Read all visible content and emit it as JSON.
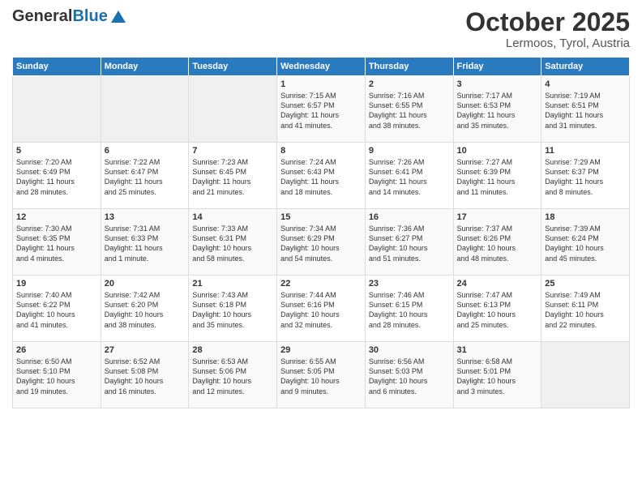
{
  "header": {
    "logo_general": "General",
    "logo_blue": "Blue",
    "month": "October 2025",
    "location": "Lermoos, Tyrol, Austria"
  },
  "weekdays": [
    "Sunday",
    "Monday",
    "Tuesday",
    "Wednesday",
    "Thursday",
    "Friday",
    "Saturday"
  ],
  "weeks": [
    [
      {
        "day": "",
        "info": ""
      },
      {
        "day": "",
        "info": ""
      },
      {
        "day": "",
        "info": ""
      },
      {
        "day": "1",
        "info": "Sunrise: 7:15 AM\nSunset: 6:57 PM\nDaylight: 11 hours\nand 41 minutes."
      },
      {
        "day": "2",
        "info": "Sunrise: 7:16 AM\nSunset: 6:55 PM\nDaylight: 11 hours\nand 38 minutes."
      },
      {
        "day": "3",
        "info": "Sunrise: 7:17 AM\nSunset: 6:53 PM\nDaylight: 11 hours\nand 35 minutes."
      },
      {
        "day": "4",
        "info": "Sunrise: 7:19 AM\nSunset: 6:51 PM\nDaylight: 11 hours\nand 31 minutes."
      }
    ],
    [
      {
        "day": "5",
        "info": "Sunrise: 7:20 AM\nSunset: 6:49 PM\nDaylight: 11 hours\nand 28 minutes."
      },
      {
        "day": "6",
        "info": "Sunrise: 7:22 AM\nSunset: 6:47 PM\nDaylight: 11 hours\nand 25 minutes."
      },
      {
        "day": "7",
        "info": "Sunrise: 7:23 AM\nSunset: 6:45 PM\nDaylight: 11 hours\nand 21 minutes."
      },
      {
        "day": "8",
        "info": "Sunrise: 7:24 AM\nSunset: 6:43 PM\nDaylight: 11 hours\nand 18 minutes."
      },
      {
        "day": "9",
        "info": "Sunrise: 7:26 AM\nSunset: 6:41 PM\nDaylight: 11 hours\nand 14 minutes."
      },
      {
        "day": "10",
        "info": "Sunrise: 7:27 AM\nSunset: 6:39 PM\nDaylight: 11 hours\nand 11 minutes."
      },
      {
        "day": "11",
        "info": "Sunrise: 7:29 AM\nSunset: 6:37 PM\nDaylight: 11 hours\nand 8 minutes."
      }
    ],
    [
      {
        "day": "12",
        "info": "Sunrise: 7:30 AM\nSunset: 6:35 PM\nDaylight: 11 hours\nand 4 minutes."
      },
      {
        "day": "13",
        "info": "Sunrise: 7:31 AM\nSunset: 6:33 PM\nDaylight: 11 hours\nand 1 minute."
      },
      {
        "day": "14",
        "info": "Sunrise: 7:33 AM\nSunset: 6:31 PM\nDaylight: 10 hours\nand 58 minutes."
      },
      {
        "day": "15",
        "info": "Sunrise: 7:34 AM\nSunset: 6:29 PM\nDaylight: 10 hours\nand 54 minutes."
      },
      {
        "day": "16",
        "info": "Sunrise: 7:36 AM\nSunset: 6:27 PM\nDaylight: 10 hours\nand 51 minutes."
      },
      {
        "day": "17",
        "info": "Sunrise: 7:37 AM\nSunset: 6:26 PM\nDaylight: 10 hours\nand 48 minutes."
      },
      {
        "day": "18",
        "info": "Sunrise: 7:39 AM\nSunset: 6:24 PM\nDaylight: 10 hours\nand 45 minutes."
      }
    ],
    [
      {
        "day": "19",
        "info": "Sunrise: 7:40 AM\nSunset: 6:22 PM\nDaylight: 10 hours\nand 41 minutes."
      },
      {
        "day": "20",
        "info": "Sunrise: 7:42 AM\nSunset: 6:20 PM\nDaylight: 10 hours\nand 38 minutes."
      },
      {
        "day": "21",
        "info": "Sunrise: 7:43 AM\nSunset: 6:18 PM\nDaylight: 10 hours\nand 35 minutes."
      },
      {
        "day": "22",
        "info": "Sunrise: 7:44 AM\nSunset: 6:16 PM\nDaylight: 10 hours\nand 32 minutes."
      },
      {
        "day": "23",
        "info": "Sunrise: 7:46 AM\nSunset: 6:15 PM\nDaylight: 10 hours\nand 28 minutes."
      },
      {
        "day": "24",
        "info": "Sunrise: 7:47 AM\nSunset: 6:13 PM\nDaylight: 10 hours\nand 25 minutes."
      },
      {
        "day": "25",
        "info": "Sunrise: 7:49 AM\nSunset: 6:11 PM\nDaylight: 10 hours\nand 22 minutes."
      }
    ],
    [
      {
        "day": "26",
        "info": "Sunrise: 6:50 AM\nSunset: 5:10 PM\nDaylight: 10 hours\nand 19 minutes."
      },
      {
        "day": "27",
        "info": "Sunrise: 6:52 AM\nSunset: 5:08 PM\nDaylight: 10 hours\nand 16 minutes."
      },
      {
        "day": "28",
        "info": "Sunrise: 6:53 AM\nSunset: 5:06 PM\nDaylight: 10 hours\nand 12 minutes."
      },
      {
        "day": "29",
        "info": "Sunrise: 6:55 AM\nSunset: 5:05 PM\nDaylight: 10 hours\nand 9 minutes."
      },
      {
        "day": "30",
        "info": "Sunrise: 6:56 AM\nSunset: 5:03 PM\nDaylight: 10 hours\nand 6 minutes."
      },
      {
        "day": "31",
        "info": "Sunrise: 6:58 AM\nSunset: 5:01 PM\nDaylight: 10 hours\nand 3 minutes."
      },
      {
        "day": "",
        "info": ""
      }
    ]
  ]
}
